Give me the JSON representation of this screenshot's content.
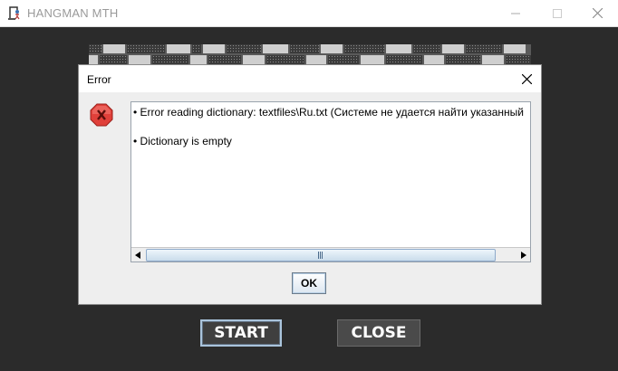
{
  "window": {
    "title": "HANGMAN MTH",
    "icons": {
      "app": "hangman-app-icon",
      "minimize": "minimize-icon",
      "maximize": "maximize-icon",
      "close": "close-icon"
    }
  },
  "main": {
    "start_label": "START",
    "close_label": "CLOSE"
  },
  "dialog": {
    "title": "Error",
    "messages": [
      "• Error reading dictionary: textfiles\\Ru.txt (Системе не удается найти указанный",
      "• Dictionary is empty"
    ],
    "ok_label": "OK",
    "icons": {
      "error": "error-icon",
      "close": "close-icon",
      "scroll_left": "arrow-left-icon",
      "scroll_right": "arrow-right-icon"
    }
  },
  "colors": {
    "background": "#2b2b2b",
    "error_red": "#e0403a",
    "accent_border": "#aac4dc"
  }
}
